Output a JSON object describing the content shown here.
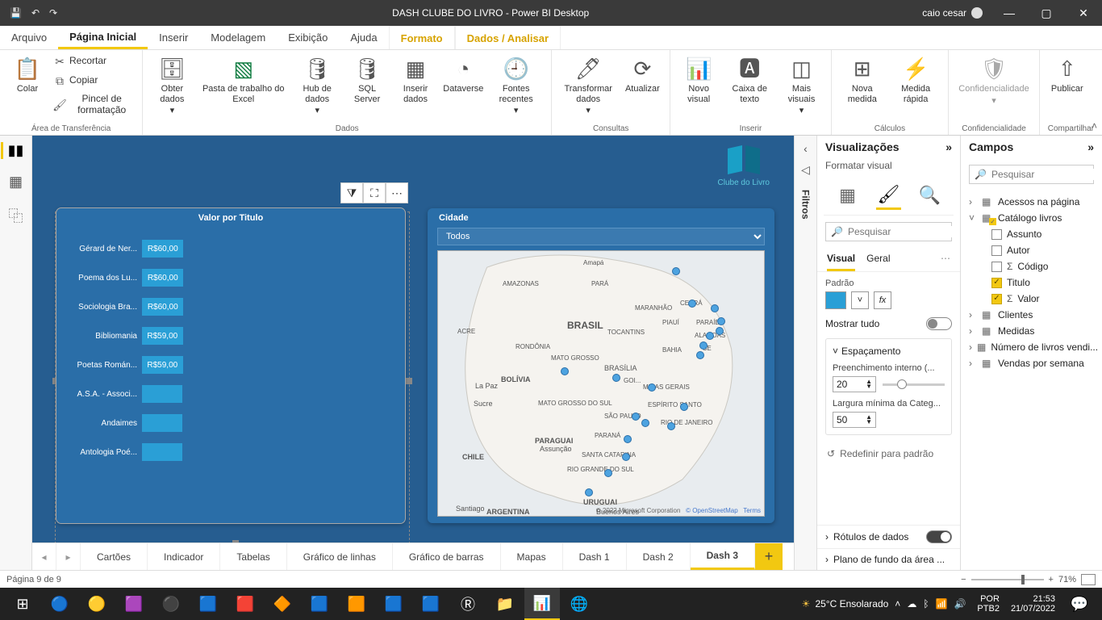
{
  "titlebar": {
    "title": "DASH CLUBE DO LIVRO - Power BI Desktop",
    "user": "caio cesar"
  },
  "menu": {
    "file": "Arquivo",
    "home": "Página Inicial",
    "insert": "Inserir",
    "model": "Modelagem",
    "view": "Exibição",
    "help": "Ajuda",
    "format": "Formato",
    "data": "Dados / Analisar"
  },
  "ribbon": {
    "paste": "Colar",
    "cut": "Recortar",
    "copy": "Copiar",
    "painter": "Pincel de formatação",
    "clipboard_group": "Área de Transferência",
    "getdata": "Obter dados",
    "excelwb": "Pasta de trabalho do Excel",
    "datahub": "Hub de dados",
    "sqlserver": "SQL Server",
    "enterdata": "Inserir dados",
    "dataverse": "Dataverse",
    "recent": "Fontes recentes",
    "data_group": "Dados",
    "transform": "Transformar dados",
    "refresh": "Atualizar",
    "queries_group": "Consultas",
    "newvisual": "Novo visual",
    "textbox": "Caixa de texto",
    "morevisuals": "Mais visuais",
    "insert_group": "Inserir",
    "newmeasure": "Nova medida",
    "quickmeasure": "Medida rápida",
    "calc_group": "Cálculos",
    "sensitivity": "Confidencialidade",
    "sens_group": "Confidencialidade",
    "publish": "Publicar",
    "share_group": "Compartilhar"
  },
  "filters_tab": "Filtros",
  "canvas": {
    "logo_text": "Clube do Livro",
    "chart_title": "Valor por Titulo",
    "slicer_label": "Cidade",
    "slicer_value": "Todos",
    "map_attrib_ms": "© 2022 Microsoft Corporation",
    "map_attrib_osm": "© OpenStreetMap",
    "map_attrib_terms": "Terms"
  },
  "chart_data": {
    "type": "bar",
    "orientation": "horizontal",
    "title": "Valor por Titulo",
    "categories": [
      "Gérard de Ner...",
      "Poema dos Lu...",
      "Sociologia Bra...",
      "Bibliomania",
      "Poetas Román...",
      "A.S.A. - Associ...",
      "Andaimes",
      "Antologia Poé..."
    ],
    "values": [
      60.0,
      60.0,
      60.0,
      59.0,
      59.0,
      58.0,
      58.0,
      58.0
    ],
    "value_labels": [
      "R$60,00",
      "R$60,00",
      "R$60,00",
      "R$59,00",
      "R$59,00",
      "",
      "",
      ""
    ],
    "xaxis_field": "Valor",
    "yaxis_field": "Titulo",
    "currency": "BRL"
  },
  "tabs": [
    "Cartões",
    "Indicador",
    "Tabelas",
    "Gráfico de linhas",
    "Gráfico de barras",
    "Mapas",
    "Dash 1",
    "Dash 2",
    "Dash 3"
  ],
  "active_tab_index": 8,
  "statusbar": {
    "page": "Página 9 de 9",
    "zoom": "71%"
  },
  "viz_pane": {
    "title": "Visualizações",
    "subtitle": "Formatar visual",
    "search_ph": "Pesquisar",
    "tab_visual": "Visual",
    "tab_general": "Geral",
    "padrao_label": "Padrão",
    "show_all": "Mostrar tudo",
    "spacing_title": "Espaçamento",
    "inner_padding_label": "Preenchimento interno (...",
    "inner_padding_value": "20",
    "min_cat_width_label": "Largura mínima da Categ...",
    "min_cat_width_value": "50",
    "reset_link": "Redefinir para padrão",
    "data_labels_title": "Rótulos de dados",
    "plot_bg_title": "Plano de fundo da área ...",
    "color_hex": "#2a9fd6"
  },
  "fields_pane": {
    "title": "Campos",
    "search_ph": "Pesquisar",
    "tables": {
      "acessos": "Acessos na página",
      "catalogo": "Catálogo livros",
      "clientes": "Clientes",
      "medidas": "Medidas",
      "num_livros": "Número de livros vendi...",
      "vendas_semana": "Vendas por semana"
    },
    "catalogo_fields": {
      "assunto": "Assunto",
      "autor": "Autor",
      "codigo": "Código",
      "titulo": "Titulo",
      "valor": "Valor"
    }
  },
  "taskbar": {
    "weather": "25°C Ensolarado",
    "lang": "POR",
    "kb": "PTB2",
    "time": "21:53",
    "date": "21/07/2022"
  }
}
